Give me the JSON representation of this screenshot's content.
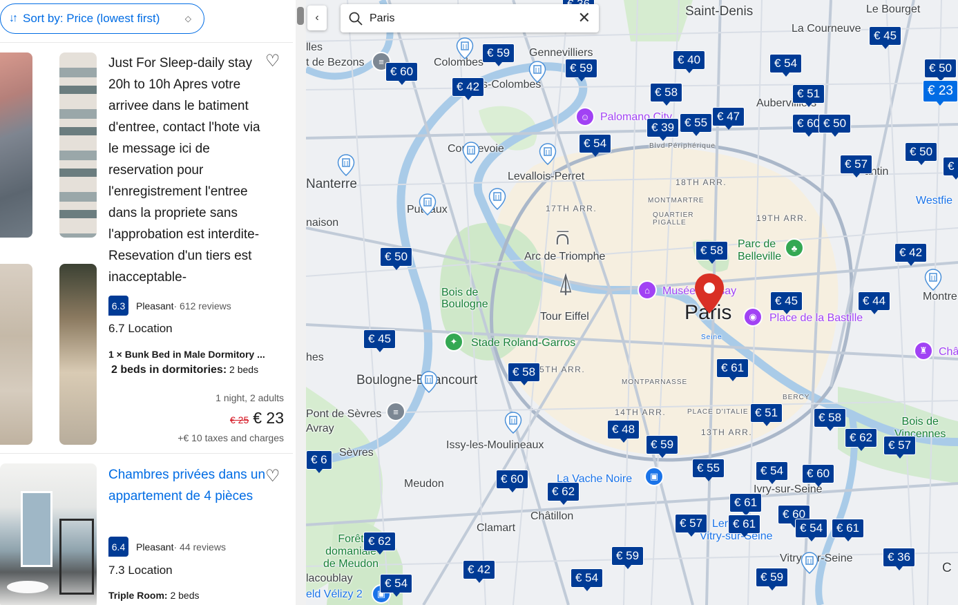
{
  "sort": {
    "label": "Sort by: Price (lowest first)",
    "icon": "sort-arrows-icon"
  },
  "listings": [
    {
      "title": "Just For Sleep-daily stay 20h to 10h Apres votre arrivee dans le batiment d'entree, contact l'hote via le message ici de reservation pour l'enregistrement l'entree dans la propriete sans l'approbation est interdite-Resevation d'un tiers est inacceptable-",
      "score": "6.3",
      "score_word": "Pleasant",
      "reviews": " · 612 reviews",
      "location": "6.7 Location",
      "room": "1 × Bunk Bed in Male Dormitory ...",
      "beds_label": "2 beds in dormitories:",
      "beds_value": " 2 beds",
      "nights": "1 night, 2 adults",
      "old_price": "€ 25",
      "price": "€ 23",
      "taxes": "+€ 10 taxes and charges"
    },
    {
      "title": "Chambres privées dans un appartement de 4 pièces",
      "score": "6.4",
      "score_word": "Pleasant",
      "reviews": " · 44 reviews",
      "location": "7.3 Location",
      "room_label": "Triple Room:",
      "room_value": " 2 beds"
    }
  ],
  "map": {
    "search_value": "Paris",
    "places": {
      "saint_denis": "Saint-Denis",
      "le_bourget": "Le Bourget",
      "la_courneuve": "La Courneuve",
      "gennevilliers": "Gennevilliers",
      "colombes": "Colombes",
      "bois_colombes": "s-Colombes",
      "aubervilliers": "Aubervilliers",
      "nanterre": "Nanterre",
      "courbevoie": "Courbevoie",
      "levallois": "Levallois-Perret",
      "puteaux": "Puteaux",
      "pantin": "Pantin",
      "arr18": "18TH ARR.",
      "arr17": "17TH ARR.",
      "arr19": "19TH ARR.",
      "montmartre": "MONTMARTRE",
      "quartier_pigalle": "QUARTIER\nPIGALLE",
      "parc_belleville": "Parc de\nBelleville",
      "arc": "Arc de Triomphe",
      "bois_boulogne": "Bois de\nBoulogne",
      "tour_eiffel": "Tour Eiffel",
      "paris": "Paris",
      "musee": "Musée d'Orsay",
      "bastille": "Place de la Bastille",
      "roland_garros": "Stade Roland-Garros",
      "boulogne": "Boulogne-Billancourt",
      "arr15": "15TH ARR.",
      "montparnasse": "MONTPARNASSE",
      "bercy": "BERCY",
      "arr14": "14TH ARR.",
      "arr13": "13TH ARR.",
      "place_italie": "PLACE D'ITALIE",
      "pont_sevres": "Pont de Sèvres",
      "avray": "Avray",
      "issy": "Issy-les-Moulineaux",
      "sevres": "Sèvres",
      "meudon": "Meudon",
      "vache_noire": "La Vache Noire",
      "ivry": "Ivry-sur-Seine",
      "chatillon": "Châtillon",
      "clamart": "Clamart",
      "foret_meudon": "Forêt\ndomaniale\nde Meudon",
      "vitry": "Vitry-sur-Seine",
      "velizy": "eld Vélizy 2",
      "villacoublay": "lacoublay",
      "bois_vincennes": "Bois de\nVincennes",
      "montreuil": "Montre",
      "westfield": "Westfie",
      "chateau": "Châ",
      "palomano": "Palomano City",
      "bezons": "t de Bezons",
      "elles": "lles",
      "maison": "naison",
      "hes": "hes",
      "seine": "Seine",
      "blvd_peripherique": "Blvd Périphérique",
      "lerc": "Lerc",
      "cr": "C"
    },
    "pins": [
      "€ 36",
      "€ 59",
      "€ 60",
      "€ 42",
      "€ 59",
      "€ 40",
      "€ 54",
      "€ 45",
      "€ 50",
      "€ 23",
      "€ 58",
      "€ 51",
      "€ 55",
      "€ 47",
      "€ 39",
      "€ 60",
      "€ 50",
      "€ 54",
      "€ 50",
      "€ 57",
      "€ 5",
      "€ 58",
      "€ 50",
      "€ 42",
      "€ 45",
      "€ 44",
      "€ 45",
      "€ 58",
      "€ 61",
      "€ 51",
      "€ 58",
      "€ 48",
      "€ 59",
      "€ 62",
      "€ 57",
      "€ 61",
      "€ 55",
      "€ 54",
      "€ 60",
      "€ 60",
      "€ 62",
      "€ 61",
      "€ 60",
      "€ 57",
      "€ 61",
      "€ 54",
      "€ 62",
      "€ 59",
      "€ 36",
      "€ 42",
      "€ 54",
      "€ 54",
      "€ 59",
      "€ 6"
    ]
  }
}
